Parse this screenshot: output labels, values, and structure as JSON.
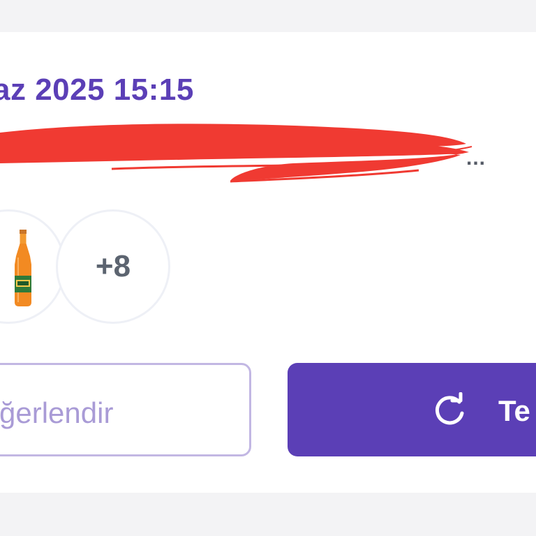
{
  "order": {
    "date_time": "az 2025 15:15",
    "address_truncation": "...",
    "more_items_count": "+8"
  },
  "actions": {
    "rate_label": "ğerlendir",
    "reorder_label": "Te"
  },
  "icons": {
    "product": "orange-soda-bottle-icon",
    "reorder": "refresh-icon"
  },
  "colors": {
    "accent": "#5b3fb6",
    "accent_light": "#a99bd6",
    "redaction": "#f03a32",
    "muted_text": "#5c6470"
  }
}
